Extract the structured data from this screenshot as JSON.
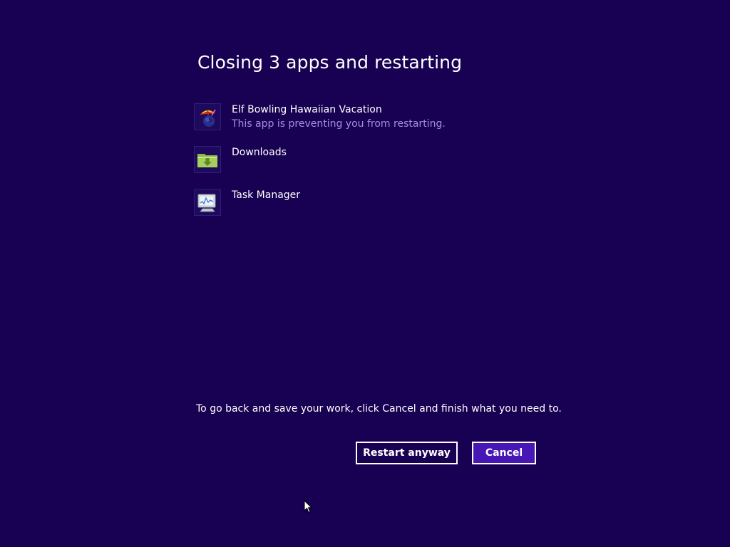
{
  "dialog": {
    "title": "Closing 3 apps and restarting",
    "hint": "To go back and save your work, click Cancel and finish what you need to."
  },
  "apps": [
    {
      "name": "Elf Bowling Hawaiian Vacation",
      "status": "This app is preventing you from restarting.",
      "icon": "elf-bowling-icon"
    },
    {
      "name": "Downloads",
      "status": "",
      "icon": "folder-download-icon"
    },
    {
      "name": "Task Manager",
      "status": "",
      "icon": "task-manager-icon"
    }
  ],
  "buttons": {
    "restart_label": "Restart anyway",
    "cancel_label": "Cancel"
  },
  "colors": {
    "background": "#180052",
    "status_text": "#a290e2",
    "cancel_button_fill": "#4617b4",
    "button_border": "#ffffff"
  }
}
